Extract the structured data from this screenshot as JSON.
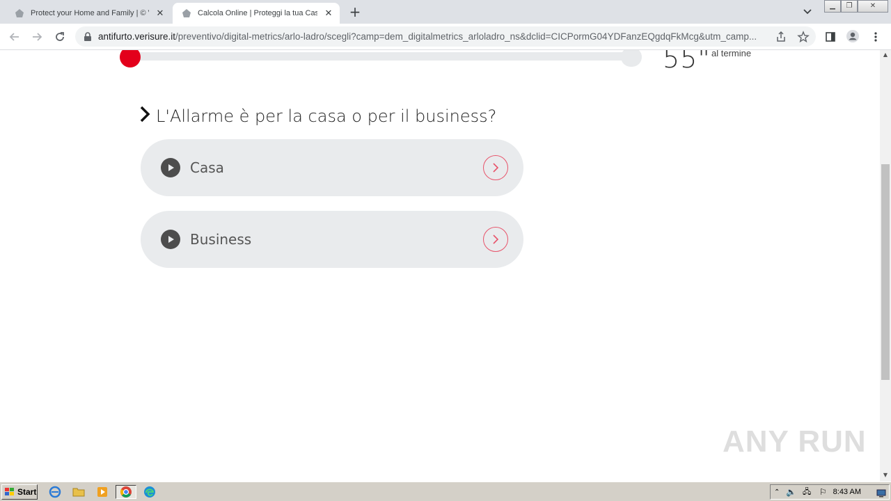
{
  "browser": {
    "tabs": [
      {
        "title": "Protect your Home and Family | © Ve",
        "active": false
      },
      {
        "title": "Calcola Online | Proteggi la tua Casa",
        "active": true
      }
    ],
    "new_tab": "+",
    "url_host": "antifurto.verisure.it",
    "url_path": "/preventivo/digital-metrics/arlo-ladro/scegli?camp=dem_digitalmetrics_arloladro_ns&dclid=CICPormG04YDFanzEQgdqFkMcg&utm_camp..."
  },
  "page": {
    "progress": 0.02,
    "timer_value": "55\"",
    "timer_note": "al termine",
    "question": "L'Allarme è per la casa o per il business?",
    "options": [
      {
        "label": "Casa"
      },
      {
        "label": "Business"
      }
    ],
    "watermark": "ANY RUN"
  },
  "taskbar": {
    "start_label": "Start",
    "clock": "8:43 AM"
  },
  "colors": {
    "accent": "#e3001b",
    "option_bg": "#e9ebed",
    "go_ring": "#e8536a"
  }
}
